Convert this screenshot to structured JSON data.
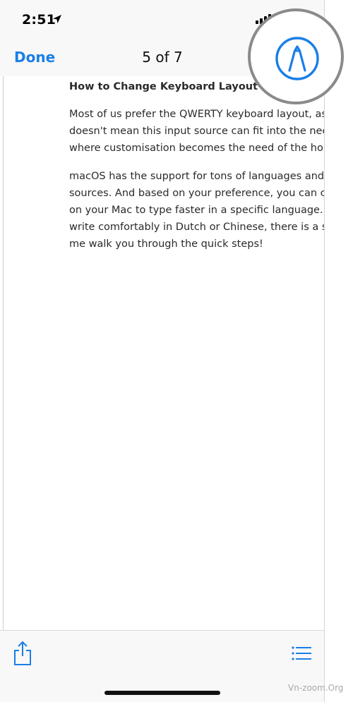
{
  "status_bar": {
    "time": "2:51"
  },
  "nav": {
    "done_label": "Done",
    "page_counter": "5 of 7"
  },
  "document": {
    "title": "How to Change Keyboard Layout on",
    "paragraph1_lines": [
      "Most of us prefer the QWERTY keyboard layout, as it",
      "doesn't mean this input source can fit into the need",
      "where customisation becomes the need of the hour."
    ],
    "paragraph2_lines": [
      "macOS has the support for tons of languages and th",
      "sources. And based on your preference, you can cha",
      "on your Mac to type faster in a specific language. So",
      "write comfortably in Dutch or Chinese, there is a sui",
      "me walk you through the quick steps!"
    ]
  },
  "watermark": "Vn-zoom.Org",
  "colors": {
    "accent": "#1a7ee6",
    "bar_background": "#f8f8f8",
    "ring": "#8a8a8a"
  },
  "icons": {
    "status": [
      "location-arrow-icon",
      "signal-icon"
    ],
    "toolbar": [
      "share-icon",
      "list-icon"
    ],
    "nav": [
      "markup-pen-icon"
    ]
  }
}
